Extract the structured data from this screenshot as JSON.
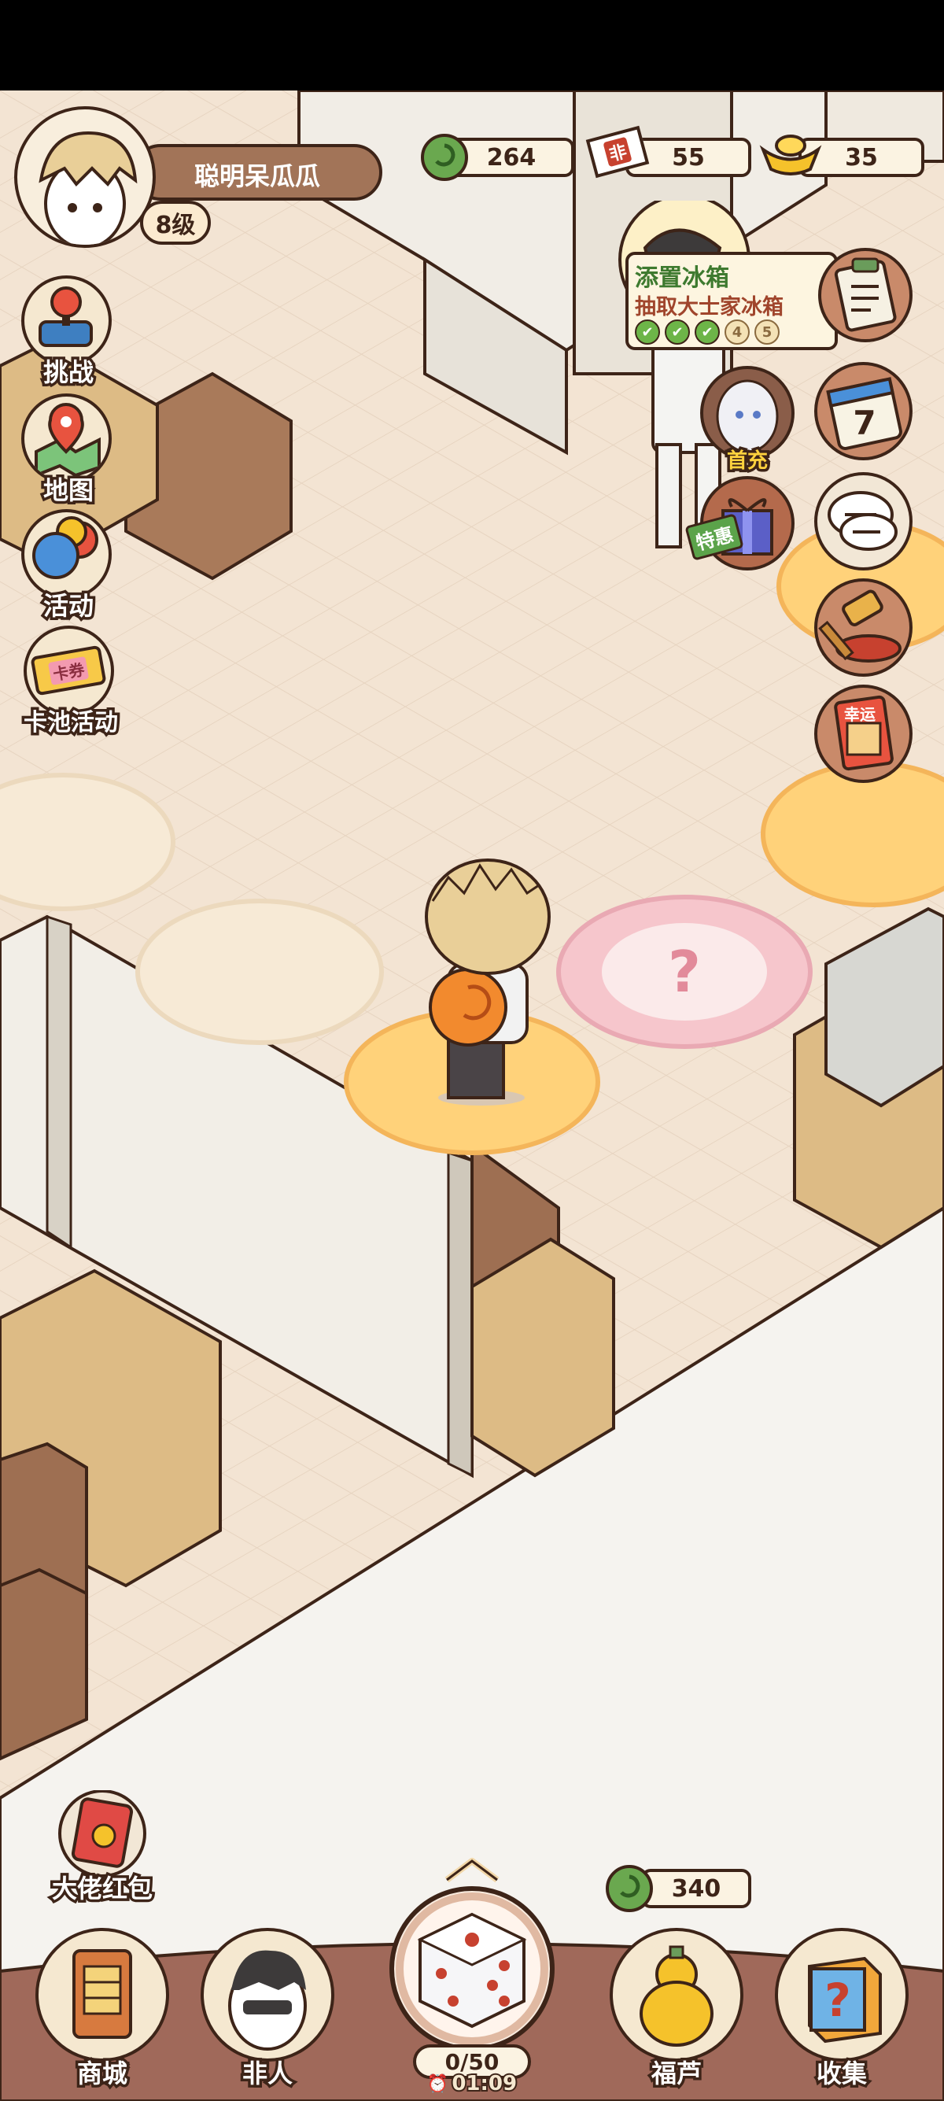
{
  "player": {
    "name": "聪明呆瓜瓜",
    "level": "8级"
  },
  "currencies": [
    {
      "icon": "green-swirl-icon",
      "value": "264"
    },
    {
      "icon": "fei-ticket-icon",
      "ticket_text": "非",
      "value": "55"
    },
    {
      "icon": "gold-ingot-icon",
      "value": "35"
    }
  ],
  "left_menu": [
    {
      "icon": "joystick-icon",
      "label": "挑战"
    },
    {
      "icon": "map-pin-icon",
      "label": "地图"
    },
    {
      "icon": "balloons-icon",
      "label": "活动"
    },
    {
      "icon": "card-ticket-icon",
      "label": "卡池活动",
      "ticket_text": "卡券"
    }
  ],
  "task": {
    "title": "添置冰箱",
    "subtitle": "抽取大士家冰箱",
    "progress": [
      "✔",
      "✔",
      "✔",
      "4",
      "5"
    ],
    "completed": 3
  },
  "right_menu": {
    "first_recharge": "首充",
    "special_offer": "特惠",
    "calendar_day": "7",
    "lucky_card": "幸运"
  },
  "bonus": {
    "label": "大佬红包"
  },
  "bottom_currency": {
    "value": "340"
  },
  "bottom_nav": [
    {
      "icon": "shop-icon",
      "label": "商城"
    },
    {
      "icon": "character-icon",
      "label": "非人"
    },
    {
      "icon": "gourd-icon",
      "label": "福芦"
    },
    {
      "icon": "mystery-box-icon",
      "label": "收集"
    }
  ],
  "dice": {
    "count": "0/50",
    "timer": "01:09"
  },
  "tile_glyph": "?",
  "colors": {
    "outline": "#3d2418",
    "floor": "#f3e6d6",
    "accent_green": "#4f8b3a",
    "accent_red": "#c7412f"
  }
}
